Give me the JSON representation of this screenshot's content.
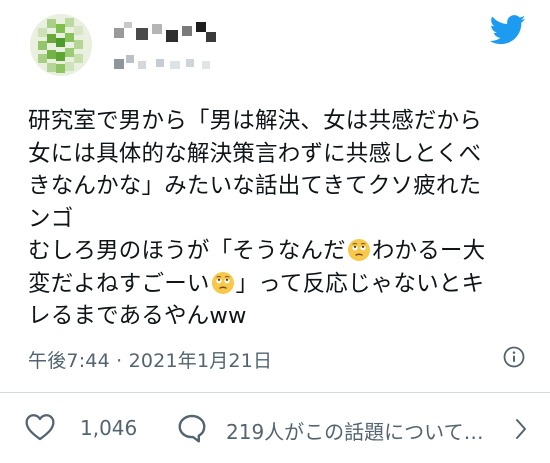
{
  "tweet": {
    "text_lines": [
      "研究室で男から「男は解決、女は共感だから",
      "女には具体的な解決策言わずに共感しとくべ",
      "きなんかな」みたいな話出てきてクソ疲れた",
      "ンゴ",
      "むしろ男のほうが「そうなんだ",
      "わかるー大",
      "変だよねすごーい",
      "」って反応じゃないとキ",
      "レるまであるやんww"
    ],
    "timestamp": "午後7:44 · 2021年1月21日"
  },
  "actions": {
    "like_count": "1,046",
    "reply_text": "219人がこの話題について…"
  },
  "icons": {
    "brand": "twitter-bird-icon",
    "like": "heart-icon",
    "reply": "speech-bubble-icon",
    "info": "info-icon",
    "chevron": "chevron-right-icon",
    "emoji": "face-with-rolling-eyes-emoji"
  },
  "colors": {
    "twitter_blue": "#1d9bf0",
    "text_primary": "#0f1419",
    "text_secondary": "#536471",
    "divider": "#cfd9de",
    "emoji_yellow": "#f7c84a"
  }
}
